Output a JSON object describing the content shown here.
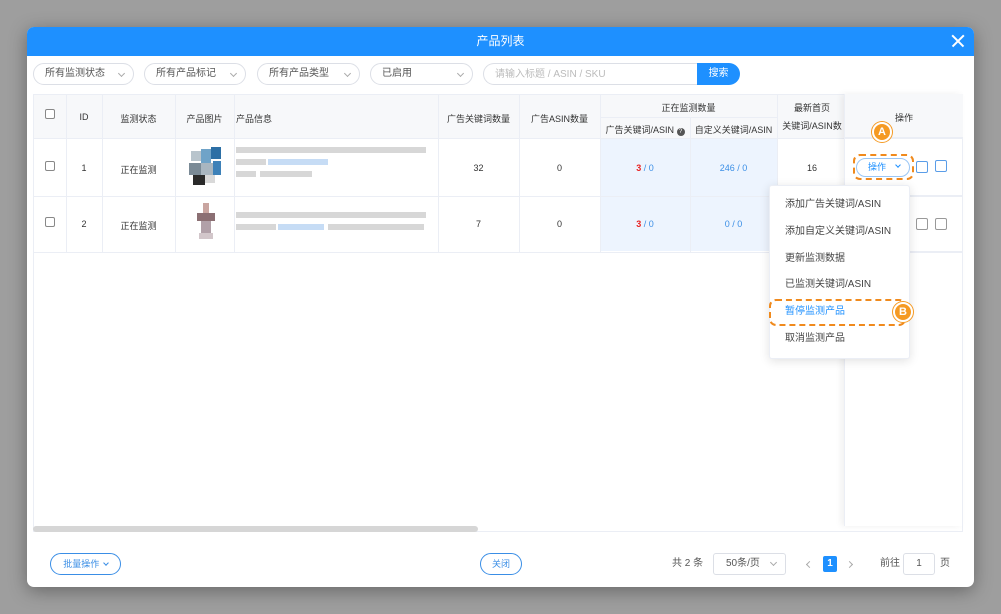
{
  "dialog": {
    "title": "产品列表"
  },
  "filters": {
    "monitor_status": "所有监测状态",
    "product_tag": "所有产品标记",
    "product_type": "所有产品类型",
    "enabled": "已启用",
    "search_placeholder": "请输入标题 / ASIN / SKU",
    "search_button": "搜索"
  },
  "table": {
    "headers": {
      "id": "ID",
      "status": "监测状态",
      "image": "产品图片",
      "info": "产品信息",
      "ad_kw_count": "广告关键词数量",
      "ad_asin_count": "广告ASIN数量",
      "monitoring": "正在监测数量",
      "monitoring_ad": "广告关键词/ASIN",
      "monitoring_custom": "自定义关键词/ASIN",
      "first_page": "最新首页",
      "first_page_sub": "关键词/ASIN数",
      "actions": "操作"
    },
    "rows": [
      {
        "id": "1",
        "status": "正在监测",
        "ad_kw": "32",
        "ad_asin": "0",
        "mon_ad_red": "3",
        "mon_ad_rest": " / 0",
        "mon_custom": "246 / 0",
        "first_page": "16"
      },
      {
        "id": "2",
        "status": "正在监测",
        "ad_kw": "7",
        "ad_asin": "0",
        "mon_ad_red": "3",
        "mon_ad_rest": " / 0",
        "mon_custom": "0 / 0",
        "first_page": ""
      }
    ]
  },
  "action_button": "操作",
  "badges": {
    "a": "A",
    "b": "B"
  },
  "dropdown": {
    "items": [
      "添加广告关键词/ASIN",
      "添加自定义关键词/ASIN",
      "更新监测数据",
      "已监测关键词/ASIN",
      "暂停监测产品",
      "取消监测产品"
    ],
    "active_index": 4
  },
  "footer": {
    "batch": "批量操作",
    "close": "关闭",
    "total": "共 2 条",
    "page_size": "50条/页",
    "current_page": "1",
    "goto": "前往",
    "goto_value": "1",
    "page_unit": "页"
  },
  "colors": {
    "accent": "#1e90ff",
    "highlight": "#f08a1d",
    "red": "#e82323"
  }
}
